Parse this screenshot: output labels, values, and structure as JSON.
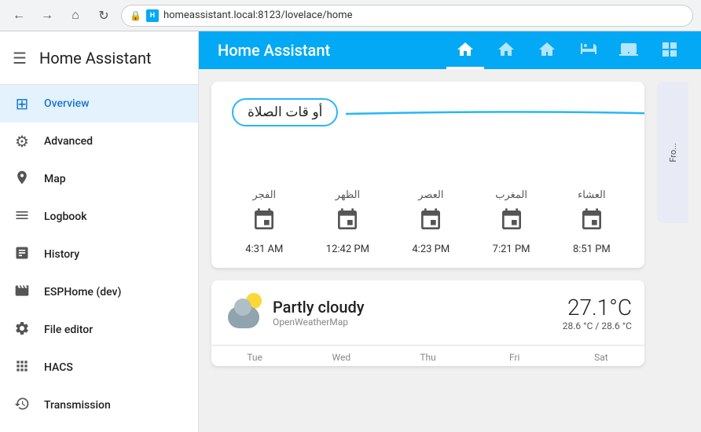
{
  "browser": {
    "back_icon": "←",
    "forward_icon": "→",
    "home_icon": "⌂",
    "reload_icon": "↻",
    "url": "homeassistant.local:8123/lovelace/home",
    "lock_icon": "🔒",
    "favicon_text": "H"
  },
  "sidebar": {
    "title": "Home Assistant",
    "hamburger_icon": "☰",
    "items": [
      {
        "label": "Overview",
        "icon": "⊞",
        "active": true
      },
      {
        "label": "Advanced",
        "icon": "⚙",
        "active": false
      },
      {
        "label": "Map",
        "icon": "👤",
        "active": false
      },
      {
        "label": "Logbook",
        "icon": "☰",
        "active": false
      },
      {
        "label": "History",
        "icon": "📊",
        "active": false
      },
      {
        "label": "ESPHome (dev)",
        "icon": "🎞",
        "active": false
      },
      {
        "label": "File editor",
        "icon": "🔧",
        "active": false
      },
      {
        "label": "HACS",
        "icon": "🔲",
        "active": false
      },
      {
        "label": "Transmission",
        "icon": "🕐",
        "active": false
      }
    ]
  },
  "topbar": {
    "title": "Home Assistant",
    "tabs": [
      {
        "icon": "🏠",
        "active": true
      },
      {
        "icon": "🏠",
        "active": false
      },
      {
        "icon": "🏠",
        "active": false
      },
      {
        "icon": "🛁",
        "active": false
      },
      {
        "icon": "🖥",
        "active": false
      },
      {
        "icon": "⊞",
        "active": false
      }
    ]
  },
  "prayer_card": {
    "annotation_text": "أو قات الصلاة",
    "times": [
      {
        "name": "الفجر",
        "time": "4:31 AM"
      },
      {
        "name": "الظهر",
        "time": "12:42 PM"
      },
      {
        "name": "العصر",
        "time": "4:23 PM"
      },
      {
        "name": "المغرب",
        "time": "7:21 PM"
      },
      {
        "name": "العشاء",
        "time": "8:51 PM"
      }
    ]
  },
  "weather_card": {
    "condition": "Partly cloudy",
    "source": "OpenWeatherMap",
    "temperature": "27.1°C",
    "range": "28.6 °C / 28.6 °C",
    "days": [
      "Tue",
      "Wed",
      "Thu",
      "Fri",
      "Sat"
    ]
  },
  "right_partial": {
    "text": "Fro..."
  }
}
